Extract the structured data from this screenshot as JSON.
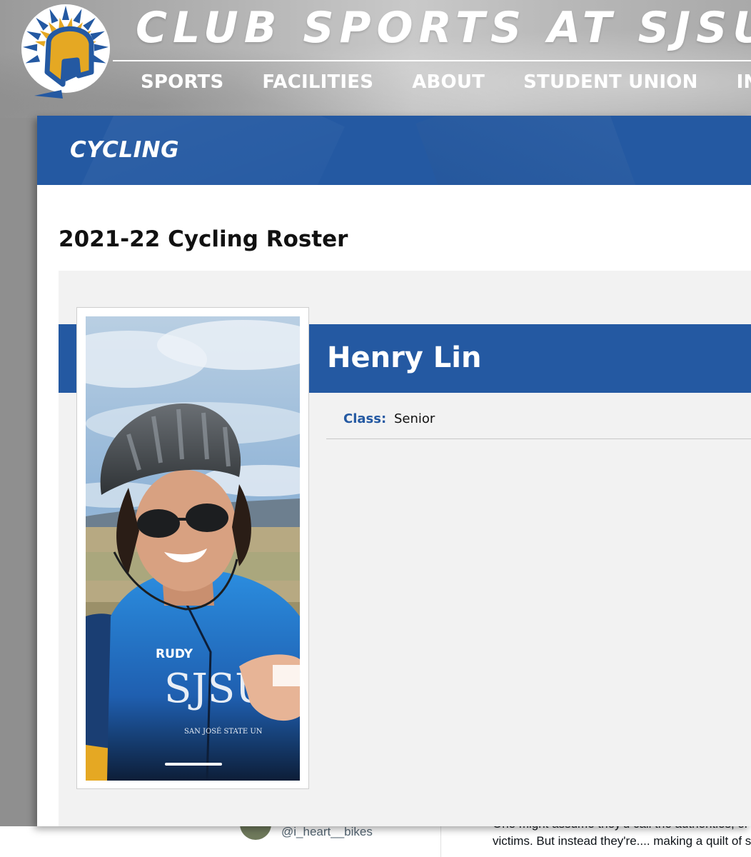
{
  "header": {
    "site_title": "CLUB SPORTS AT SJSU",
    "nav": [
      "SPORTS",
      "FACILITIES",
      "ABOUT",
      "STUDENT UNION",
      "INSID"
    ],
    "logo_icon": "spartan-helmet-icon"
  },
  "sport": {
    "name": "CYCLING"
  },
  "roster": {
    "title": "2021-22 Cycling Roster",
    "athlete": {
      "name": "Henry Lin",
      "fields": [
        {
          "label": "Class:",
          "value": "Senior"
        }
      ],
      "jersey_text": "SJSU",
      "jersey_sponsor": "RUDY",
      "jersey_caption": "SAN JOSÉ STATE UN"
    }
  },
  "background_tweet": {
    "handle": "@i_heart__bikes",
    "line1": "One might assume they'd call the authorities, or",
    "line2": "victims. But  instead they're.... making a quilt of s"
  },
  "colors": {
    "sjsu_blue": "#2459a2",
    "sjsu_gold": "#e5a823",
    "panel_gray": "#f2f2f2"
  }
}
